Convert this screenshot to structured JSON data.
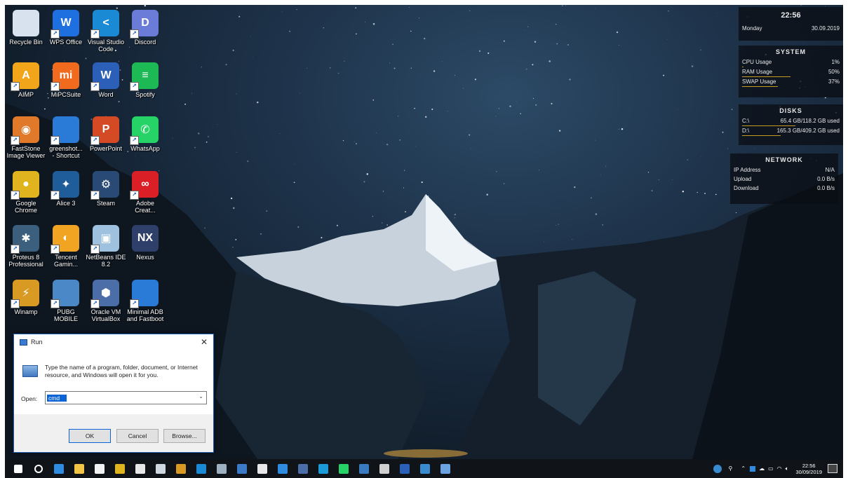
{
  "desktop_icons": [
    {
      "label": "Recycle Bin",
      "icon": "recycle-bin-icon",
      "color": "#d7e2ee",
      "text": "",
      "shortcut": false
    },
    {
      "label": "WPS Office",
      "icon": "wps-office-icon",
      "color": "#1e6fe0",
      "text": "W",
      "shortcut": true
    },
    {
      "label": "Visual Studio\nCode",
      "icon": "vscode-icon",
      "color": "#1a8ad4",
      "text": "<",
      "shortcut": true
    },
    {
      "label": "Discord",
      "icon": "discord-icon",
      "color": "#6b7bd8",
      "text": "D",
      "shortcut": true
    },
    {
      "label": "AIMP",
      "icon": "aimp-icon",
      "color": "#f1a51a",
      "text": "A",
      "shortcut": true
    },
    {
      "label": "MiPCSuite",
      "icon": "mi-pc-suite-icon",
      "color": "#f26a1d",
      "text": "mi",
      "shortcut": true
    },
    {
      "label": "Word",
      "icon": "word-icon",
      "color": "#2b5fb8",
      "text": "W",
      "shortcut": true
    },
    {
      "label": "Spotify",
      "icon": "spotify-icon",
      "color": "#1db954",
      "text": "≡",
      "shortcut": true
    },
    {
      "label": "FastStone\nImage Viewer",
      "icon": "faststone-icon",
      "color": "#e07a2a",
      "text": "◉",
      "shortcut": true
    },
    {
      "label": "greenshot...\n- Shortcut",
      "icon": "greenshot-icon",
      "color": "#2a7ad8",
      "text": "",
      "shortcut": true
    },
    {
      "label": "PowerPoint",
      "icon": "powerpoint-icon",
      "color": "#d34a25",
      "text": "P",
      "shortcut": true
    },
    {
      "label": "WhatsApp",
      "icon": "whatsapp-icon",
      "color": "#25d366",
      "text": "✆",
      "shortcut": true
    },
    {
      "label": "Google\nChrome",
      "icon": "chrome-icon",
      "color": "#e0b41f",
      "text": "●",
      "shortcut": true
    },
    {
      "label": "Alice 3",
      "icon": "alice-icon",
      "color": "#1e5c9a",
      "text": "✦",
      "shortcut": true
    },
    {
      "label": "Steam",
      "icon": "steam-icon",
      "color": "#2a4a76",
      "text": "⚙",
      "shortcut": true
    },
    {
      "label": "Adobe\nCreat...",
      "icon": "adobe-cc-icon",
      "color": "#da1f26",
      "text": "∞",
      "shortcut": true
    },
    {
      "label": "Proteus 8\nProfessional",
      "icon": "proteus-icon",
      "color": "#3c5f7d",
      "text": "✱",
      "shortcut": true
    },
    {
      "label": "Tencent\nGamin...",
      "icon": "tencent-gaming-icon",
      "color": "#f0a422",
      "text": "◐",
      "shortcut": true
    },
    {
      "label": "NetBeans IDE\n8.2",
      "icon": "netbeans-icon",
      "color": "#9fc1e0",
      "text": "▣",
      "shortcut": true
    },
    {
      "label": "Nexus",
      "icon": "nexus-icon",
      "color": "#2e3f6a",
      "text": "NX",
      "shortcut": false
    },
    {
      "label": "Winamp",
      "icon": "winamp-icon",
      "color": "#d89a22",
      "text": "⚡",
      "shortcut": true
    },
    {
      "label": "PUBG\nMOBILE",
      "icon": "pubg-icon",
      "color": "#4a88c8",
      "text": "",
      "shortcut": true
    },
    {
      "label": "Oracle VM\nVirtualBox",
      "icon": "virtualbox-icon",
      "color": "#4b6ea8",
      "text": "⬢",
      "shortcut": true
    },
    {
      "label": "Minimal ADB\nand Fastboot",
      "icon": "minimal-adb-icon",
      "color": "#2a7ad8",
      "text": "",
      "shortcut": true
    }
  ],
  "clock_widget": {
    "time": "22:56",
    "day": "Monday",
    "date": "30.09.2019"
  },
  "system_widget": {
    "title": "SYSTEM",
    "rows": [
      {
        "label": "CPU Usage",
        "value": "1%"
      },
      {
        "label": "RAM Usage",
        "value": "50%"
      },
      {
        "label": "SWAP Usage",
        "value": "37%"
      }
    ]
  },
  "disks_widget": {
    "title": "DISKS",
    "rows": [
      {
        "label": "C:\\",
        "value": "65.4 GB/118.2 GB used"
      },
      {
        "label": "D:\\",
        "value": "165.3 GB/409.2 GB used"
      }
    ]
  },
  "network_widget": {
    "title": "NETWORK",
    "rows": [
      {
        "label": "IP Address",
        "value": "N/A"
      },
      {
        "label": "Upload",
        "value": "0.0 B/s"
      },
      {
        "label": "Download",
        "value": "0.0 B/s"
      }
    ]
  },
  "run_dialog": {
    "title": "Run",
    "description": "Type the name of a program, folder, document, or Internet resource, and Windows will open it for you.",
    "open_label": "Open:",
    "open_value": "cmd",
    "ok_label": "OK",
    "cancel_label": "Cancel",
    "browse_label": "Browse..."
  },
  "taskbar": {
    "icons": [
      {
        "name": "start-icon",
        "color": "#ffffff"
      },
      {
        "name": "search-icon",
        "color": "#ffffff"
      },
      {
        "name": "edge-icon",
        "color": "#2f8be0"
      },
      {
        "name": "file-explorer-icon",
        "color": "#f2c546"
      },
      {
        "name": "store-icon",
        "color": "#f2f2f2"
      },
      {
        "name": "chrome-icon",
        "color": "#e0b41f"
      },
      {
        "name": "dropbox-icon",
        "color": "#e8e8e8"
      },
      {
        "name": "steam-icon",
        "color": "#cfd8e0"
      },
      {
        "name": "winamp-icon",
        "color": "#d89a22"
      },
      {
        "name": "vscode-icon",
        "color": "#1a8ad4"
      },
      {
        "name": "proteus-icon",
        "color": "#9fb0c0"
      },
      {
        "name": "app-icon",
        "color": "#3c7ac8"
      },
      {
        "name": "slack-icon",
        "color": "#e8e8e8"
      },
      {
        "name": "checkmark-icon",
        "color": "#2f8be0"
      },
      {
        "name": "virtualbox-icon",
        "color": "#4b6ea8"
      },
      {
        "name": "photoshop-icon",
        "color": "#1b9bd8"
      },
      {
        "name": "whatsapp-icon",
        "color": "#25d366"
      },
      {
        "name": "notes-icon",
        "color": "#3a7ac0"
      },
      {
        "name": "window-icon",
        "color": "#d0d0d0"
      },
      {
        "name": "word-icon",
        "color": "#2b5fb8"
      },
      {
        "name": "phone-icon",
        "color": "#3a8ad0"
      },
      {
        "name": "active-window-icon",
        "color": "#6aa3e0"
      }
    ],
    "clock_time": "22:56",
    "clock_date": "30/09/2019"
  }
}
